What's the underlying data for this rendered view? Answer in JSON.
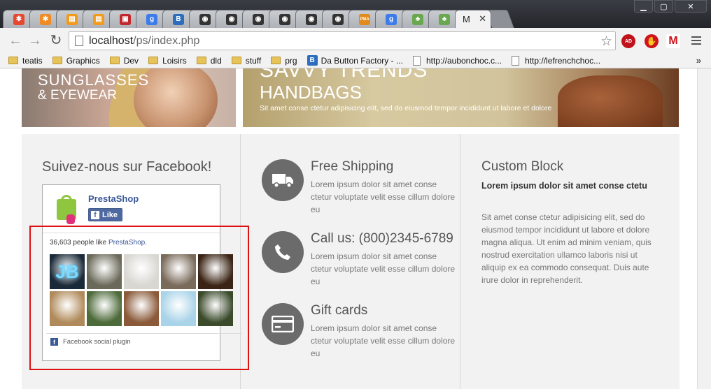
{
  "browser": {
    "tabs": [
      {
        "icon": "joomla-icon",
        "color": "#e8462f",
        "glyph": "✱"
      },
      {
        "icon": "joomla-icon",
        "color": "#f08a24",
        "glyph": "✱"
      },
      {
        "icon": "package-icon",
        "color": "#f39a1b",
        "glyph": "▤"
      },
      {
        "icon": "package-icon",
        "color": "#f39a1b",
        "glyph": "▤"
      },
      {
        "icon": "red-app-icon",
        "color": "#c1272d",
        "glyph": "▣"
      },
      {
        "icon": "google-icon",
        "color": "#3c7cea",
        "glyph": "g"
      },
      {
        "icon": "b-icon",
        "color": "#2d6dbd",
        "glyph": "B"
      },
      {
        "icon": "eye-icon",
        "color": "#333333",
        "glyph": "◉"
      },
      {
        "icon": "eye-icon",
        "color": "#333333",
        "glyph": "◉"
      },
      {
        "icon": "eye-icon",
        "color": "#333333",
        "glyph": "◉"
      },
      {
        "icon": "eye-icon",
        "color": "#333333",
        "glyph": "◉"
      },
      {
        "icon": "eye-icon",
        "color": "#333333",
        "glyph": "◉"
      },
      {
        "icon": "eye-icon",
        "color": "#333333",
        "glyph": "◉"
      },
      {
        "icon": "pma-icon",
        "color": "#e28a1e",
        "glyph": "PMA"
      },
      {
        "icon": "google-icon",
        "color": "#3c7cea",
        "glyph": "g"
      },
      {
        "icon": "leaf-icon",
        "color": "#6aa84f",
        "glyph": "♣"
      },
      {
        "icon": "leaf-icon",
        "color": "#6aa84f",
        "glyph": "♣"
      }
    ],
    "active_tab_label": "M",
    "active_tab_close": "✕",
    "window_controls": {
      "minimize": "▁",
      "maximize": "▢",
      "close": "✕"
    },
    "url_host": "localhost",
    "url_path": "/ps/index.php",
    "bookmarks": [
      {
        "type": "folder",
        "label": "teatis"
      },
      {
        "type": "folder",
        "label": "Graphics"
      },
      {
        "type": "folder",
        "label": "Dev"
      },
      {
        "type": "folder",
        "label": "Loisirs"
      },
      {
        "type": "folder",
        "label": "dld"
      },
      {
        "type": "folder",
        "label": "stuff"
      },
      {
        "type": "folder",
        "label": "prg"
      },
      {
        "type": "badge",
        "label": "Da Button Factory - ..."
      },
      {
        "type": "page",
        "label": "http://aubonchoc.c..."
      },
      {
        "type": "page",
        "label": "http://lefrenchchoc..."
      }
    ],
    "bookmarks_more": "»"
  },
  "banners": {
    "left_line1": "SUNGLASSES",
    "left_line2": "& EYEWEAR",
    "right_line0": "SAVVY TRENDS",
    "right_line1": "HANDBAGS",
    "right_line2": "Sit amet conse ctetur adipisicing elit, sed do eiusmod tempor incididunt ut labore et dolore"
  },
  "facebook": {
    "title": "Suivez-nous sur Facebook!",
    "page_name": "PrestaShop",
    "like_label": "Like",
    "count_text": "36,603 people like ",
    "count_link": "PrestaShop",
    "count_end": ".",
    "faces": [
      {
        "name": "JB",
        "color": "#1b2a38"
      },
      {
        "name": "dog",
        "color": "#6b6a5a"
      },
      {
        "name": "cat",
        "color": "#d9d7d2"
      },
      {
        "name": "couple",
        "color": "#7a6a5a"
      },
      {
        "name": "woman",
        "color": "#3b2415"
      },
      {
        "name": "teddy",
        "color": "#b08a5a"
      },
      {
        "name": "group",
        "color": "#4d6a3a"
      },
      {
        "name": "kids",
        "color": "#8a5a3a"
      },
      {
        "name": "cartoon",
        "color": "#a9d3e8"
      },
      {
        "name": "bird",
        "color": "#3a4a2a"
      }
    ],
    "footer": "Facebook social plugin"
  },
  "services": [
    {
      "icon": "truck-icon",
      "title": "Free Shipping",
      "text": "Lorem ipsum dolor sit amet conse ctetur voluptate velit esse cillum dolore eu"
    },
    {
      "icon": "phone-icon",
      "title": "Call us: (800)2345-6789",
      "text": "Lorem ipsum dolor sit amet conse ctetur voluptate velit esse cillum dolore eu"
    },
    {
      "icon": "credit-card-icon",
      "title": "Gift cards",
      "text": "Lorem ipsum dolor sit amet conse ctetur voluptate velit esse cillum dolore eu"
    }
  ],
  "custom_block": {
    "title": "Custom Block",
    "strong": "Lorem ipsum dolor sit amet conse ctetu",
    "text": "Sit amet conse ctetur adipisicing elit, sed do eiusmod tempor incididunt ut labore et dolore magna aliqua. Ut enim ad minim veniam, quis nostrud exercitation ullamco laboris nisi ut aliquip ex ea commodo consequat. Duis aute irure dolor in reprehenderit."
  }
}
